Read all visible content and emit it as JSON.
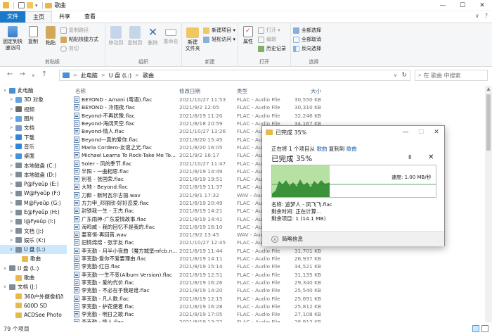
{
  "window": {
    "title": "歌曲",
    "controls": [
      "—",
      "☐",
      "✕"
    ]
  },
  "ribbon_tabs": {
    "file": "文件",
    "home": "主页",
    "share": "共享",
    "view": "查看"
  },
  "ribbon_right": {
    "collapse": "∨",
    "help": "?"
  },
  "ribbon": {
    "clipboard": {
      "label": "剪贴板",
      "pin": "固定到快\n速访问",
      "copy": "复制",
      "paste": "粘贴",
      "cut": "剪切",
      "copy_path": "复制路径",
      "paste_shortcut": "粘贴快捷方式"
    },
    "organize": {
      "label": "组织",
      "move_to": "移动到",
      "copy_to": "复制到",
      "delete": "删除",
      "rename": "重命名"
    },
    "new": {
      "label": "新建",
      "new_folder": "新建\n文件夹",
      "new_item": "新建项目 ▾",
      "easy_access": "轻松访问 ▾"
    },
    "open": {
      "label": "打开",
      "properties": "属性",
      "open": "打开 ▾",
      "edit": "编辑",
      "history": "历史记录"
    },
    "select": {
      "label": "选择",
      "select_all": "全部选择",
      "select_none": "全部取消",
      "invert": "反向选择"
    }
  },
  "address": {
    "nav_back": "←",
    "nav_forward": "→",
    "nav_recent": "∨",
    "nav_up": "↑",
    "crumbs": [
      "此电脑",
      "U 盘 (L:)",
      "歌曲"
    ],
    "search_placeholder": "在 歌曲 中搜索"
  },
  "nav_pane": [
    {
      "label": "此电脑",
      "exp": "∨",
      "indent": 0,
      "color": "#4a90d9"
    },
    {
      "label": "3D 对象",
      "exp": ">",
      "indent": 1,
      "color": "#5fa3e0"
    },
    {
      "label": "视频",
      "exp": ">",
      "indent": 1,
      "color": "#6a6a6a"
    },
    {
      "label": "图片",
      "exp": ">",
      "indent": 1,
      "color": "#5fa3e0"
    },
    {
      "label": "文档",
      "exp": ">",
      "indent": 1,
      "color": "#7a9cc4"
    },
    {
      "label": "下载",
      "exp": ">",
      "indent": 1,
      "color": "#2e86de"
    },
    {
      "label": "音乐",
      "exp": ">",
      "indent": 1,
      "color": "#2e86de"
    },
    {
      "label": "桌面",
      "exp": ">",
      "indent": 1,
      "color": "#4a90d9"
    },
    {
      "label": "本地磁盘 (C:)",
      "exp": ">",
      "indent": 1,
      "color": "#7f8c99"
    },
    {
      "label": "本地磁盘 (D:)",
      "exp": ">",
      "indent": 1,
      "color": "#7f8c99"
    },
    {
      "label": "P@Fyeûp (E:)",
      "exp": ">",
      "indent": 1,
      "color": "#7f8c99"
    },
    {
      "label": "W@Fyeûp (F:)",
      "exp": ">",
      "indent": 1,
      "color": "#7f8c99"
    },
    {
      "label": "M@Fyeûp (G:)",
      "exp": ">",
      "indent": 1,
      "color": "#7f8c99"
    },
    {
      "label": "E@Fyeûp (H:)",
      "exp": ">",
      "indent": 1,
      "color": "#7f8c99"
    },
    {
      "label": "I@Fyeûp (I:)",
      "exp": ">",
      "indent": 1,
      "color": "#7f8c99"
    },
    {
      "label": "文档 (J:)",
      "exp": ">",
      "indent": 1,
      "color": "#7f8c99"
    },
    {
      "label": "娱乐 (K:)",
      "exp": ">",
      "indent": 1,
      "color": "#7f8c99"
    },
    {
      "label": "U 盘 (L:)",
      "exp": "∨",
      "indent": 1,
      "color": "#7f8c99",
      "selected": true
    },
    {
      "label": "歌曲",
      "exp": "",
      "indent": 2,
      "color": "#e8b84b"
    },
    {
      "label": "U 盘 (L:)",
      "exp": "∨",
      "indent": 0,
      "color": "#7f8c99"
    },
    {
      "label": "歌曲",
      "exp": "",
      "indent": 1,
      "color": "#e8b84b"
    },
    {
      "label": "文档 (J:)",
      "exp": "∨",
      "indent": 0,
      "color": "#7f8c99"
    },
    {
      "label": "360户外摄像机ð",
      "exp": "",
      "indent": 1,
      "color": "#e8b84b"
    },
    {
      "label": "600D SD",
      "exp": "",
      "indent": 1,
      "color": "#e8b84b"
    },
    {
      "label": "ACDSee Photo",
      "exp": "",
      "indent": 1,
      "color": "#e8b84b"
    }
  ],
  "file_list": {
    "headers": {
      "name": "名称",
      "date": "修改日期",
      "type": "类型",
      "size": "大小"
    },
    "rows": [
      {
        "name": "BEYOND - Amani (粤语).flac",
        "date": "2021/10/27 11:53",
        "type": "FLAC - Audio File",
        "size": "30,550 KB"
      },
      {
        "name": "BEYOND - 冷雨夜.flac",
        "date": "2021/9/2 12:05",
        "type": "FLAC - Audio File",
        "size": "30,310 KB"
      },
      {
        "name": "Beyond-不再犹豫.flac",
        "date": "2021/8/19 11:20",
        "type": "FLAC - Audio File",
        "size": "32,246 KB"
      },
      {
        "name": "Beyond-海阔天空.flac",
        "date": "2021/8/18 20:59",
        "type": "FLAC - Audio File",
        "size": "34,167 KB"
      },
      {
        "name": "Beyond-情人.flac",
        "date": "2021/10/27 13:26",
        "type": "FLAC - Audio File",
        "size": "30,171 KB"
      },
      {
        "name": "Beyond—真的爱你.flac",
        "date": "2021/8/20 15:45",
        "type": "FLAC - Audio File",
        "size": "31,243 KB"
      },
      {
        "name": "Maria Cordero-友谊之光.flac",
        "date": "2021/8/20 16:05",
        "type": "FLAC - Audio File",
        "size": "26,131 KB"
      },
      {
        "name": "Michael Learns To Rock-Take Me To...",
        "date": "2021/9/2 16:17",
        "type": "FLAC - Audio File",
        "size": "30,510 KB"
      },
      {
        "name": "Soler - 风的季节.flac",
        "date": "2021/10/27 11:47",
        "type": "FLAC - Audio File",
        "size": "22,147 KB"
      },
      {
        "name": "半阳 - 一曲相思.flac",
        "date": "2021/8/19 14:49",
        "type": "FLAC - Audio File",
        "size": "18,342 KB"
      },
      {
        "name": "别苍 - 张国荣.flac",
        "date": "2021/8/19 19:51",
        "type": "FLAC - Audio File",
        "size": "27,316 KB"
      },
      {
        "name": "大地 - Beyond.flac",
        "date": "2021/8/19 11:37",
        "type": "FLAC - Audio File",
        "size": "30,524 KB"
      },
      {
        "name": "刀郎 - 新阿瓦尔古丽.wav",
        "date": "2021/9/1 17:32",
        "type": "WAV - Audio File",
        "size": "46,341 KB"
      },
      {
        "name": "方力申_邓丽欣-好好恋爱.flac",
        "date": "2021/8/19 20:49",
        "type": "FLAC - Audio File",
        "size": "28,241 KB"
      },
      {
        "name": "封锁我一生 - 王杰.flac",
        "date": "2021/8/19 14:21",
        "type": "FLAC - Audio File",
        "size": "26,502 KB"
      },
      {
        "name": "广东雨神-广东爱情故事.flac",
        "date": "2021/8/19 14:41",
        "type": "FLAC - Audio File",
        "size": "28,176 KB"
      },
      {
        "name": "海鸣威 - 我的回忆不是我的.flac",
        "date": "2021/8/19 16:10",
        "type": "FLAC - Audio File",
        "size": "29,380 KB"
      },
      {
        "name": "姜育恒-再回首.wav",
        "date": "2021/9/2 13:45",
        "type": "WAV - Audio File",
        "size": "42,481 KB"
      },
      {
        "name": "旧情绵绵 - 张学友.flac",
        "date": "2021/10/27 12:45",
        "type": "FLAC - Audio File",
        "size": "30,421 KB"
      },
      {
        "name": "李克勤 - 月半小夜曲（魔方城堡mfcb.ne...",
        "date": "2021/8/19 11:44",
        "type": "FLAC - Audio File",
        "size": "31,701 KB"
      },
      {
        "name": "李克勤-爱你不爱要理由.flac",
        "date": "2021/8/19 14:11",
        "type": "FLAC - Audio File",
        "size": "26,937 KB"
      },
      {
        "name": "李克勤-红日.flac",
        "date": "2021/8/19 15:14",
        "type": "FLAC - Audio File",
        "size": "34,521 KB"
      },
      {
        "name": "李克勤-一生不变(Album Version).flac",
        "date": "2021/8/19 12:51",
        "type": "FLAC - Audio File",
        "size": "31,135 KB"
      },
      {
        "name": "李克勤 - 爱的代价.flac",
        "date": "2021/8/19 16:26",
        "type": "FLAC - Audio File",
        "size": "29,340 KB"
      },
      {
        "name": "李克勤 - 不必在乎我是谁.flac",
        "date": "2021/8/19 14:20",
        "type": "FLAC - Audio File",
        "size": "25,540 KB"
      },
      {
        "name": "李克勤 - 凡人歌.flac",
        "date": "2021/8/19 12:15",
        "type": "FLAC - Audio File",
        "size": "25,691 KB"
      },
      {
        "name": "李克勤 - 护花使者.flac",
        "date": "2021/8/19 16:28",
        "type": "FLAC - Audio File",
        "size": "25,812 KB"
      },
      {
        "name": "李克勤 - 明日之歌.flac",
        "date": "2021/8/19 17:05",
        "type": "FLAC - Audio File",
        "size": "27,108 KB"
      },
      {
        "name": "李克勤 - 情人.flac",
        "date": "2021/8/19 13:22",
        "type": "FLAC - Audio File",
        "size": "28,913 KB"
      }
    ]
  },
  "status": {
    "count": "79 个项目"
  },
  "dialog": {
    "title": "已完成 35%",
    "controls": [
      "—",
      "☐",
      "✕"
    ],
    "copy_prefix": "正在将 1 个项目从 ",
    "source": "歌曲",
    "copy_mid": " 复制到 ",
    "dest": "歌曲",
    "percent_text": "已完成 35%",
    "pause": "II",
    "cancel": "✕",
    "progress": 0.35,
    "speed": "速度: 1.00 MB/秒",
    "name_line": "名称: 追梦人 - 凤飞飞.flac",
    "time_line": "剩余时间: 正在计算...",
    "items_line": "剩余项目: 1 (14.1 MB)",
    "more": "简略信息"
  },
  "colors": {
    "accent": "#1979ca",
    "progress_fill": "#b7e0a3",
    "progress_line": "#2f8a2f",
    "link": "#1a5fb4"
  }
}
